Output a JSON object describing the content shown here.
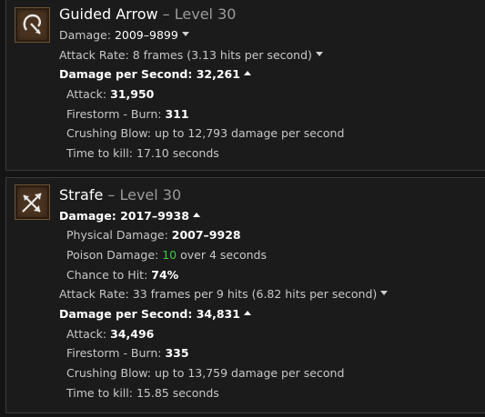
{
  "skills": [
    {
      "name": "Guided Arrow",
      "level": "– Level 30",
      "icon": "guided-arrow-icon",
      "damage_label": "Damage:",
      "damage_value": "2009–9899",
      "attack_rate_label": "Attack Rate:",
      "attack_rate_value": "8 frames (3.13 hits per second)",
      "dps_label": "Damage per Second:",
      "dps_value": "32,261",
      "attack_label": "Attack:",
      "attack_value": "31,950",
      "firestorm_label": "Firestorm - Burn:",
      "firestorm_value": "311",
      "crushing_label": "Crushing Blow:",
      "crushing_value": "up to 12,793 damage per second",
      "ttk_label": "Time to kill:",
      "ttk_value": "17.10 seconds"
    },
    {
      "name": "Strafe",
      "level": "– Level 30",
      "icon": "strafe-icon",
      "damage_label": "Damage:",
      "damage_value": "2017–9938",
      "physical_label": "Physical Damage:",
      "physical_value": "2007–9928",
      "poison_label": "Poison Damage:",
      "poison_value": "10",
      "poison_suffix": "over 4 seconds",
      "cth_label": "Chance to Hit:",
      "cth_value": "74%",
      "attack_rate_label": "Attack Rate:",
      "attack_rate_value": "33 frames per 9 hits (6.82 hits per second)",
      "dps_label": "Damage per Second:",
      "dps_value": "34,831",
      "attack_label": "Attack:",
      "attack_value": "34,496",
      "firestorm_label": "Firestorm - Burn:",
      "firestorm_value": "335",
      "crushing_label": "Crushing Blow:",
      "crushing_value": "up to 13,759 damage per second",
      "ttk_label": "Time to kill:",
      "ttk_value": "15.85 seconds"
    }
  ],
  "colors": {
    "background": "#141414",
    "panel": "#1b1b1b",
    "poison_green": "#3ec83e"
  }
}
